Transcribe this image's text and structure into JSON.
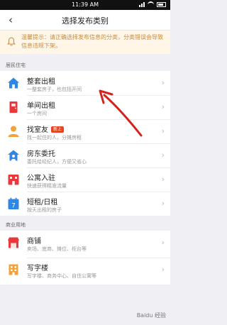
{
  "status_bar": {
    "time": "11:39 AM"
  },
  "header": {
    "title": "选择发布类别"
  },
  "notice": {
    "text": "温馨提示：请正确选择发布信息的分类，分类错误会导致信息违规下架。"
  },
  "sections": [
    {
      "title": "居民住宅",
      "items": [
        {
          "name": "整套出租",
          "desc": "一整套房子，也包括开间",
          "icon": "house-icon",
          "color": "#2f86e5"
        },
        {
          "name": "单间出租",
          "desc": "一个房间",
          "icon": "door-icon",
          "color": "#e9373a"
        },
        {
          "name": "找室友",
          "badge": "新上",
          "desc": "找一起住的人，分摊房租",
          "icon": "person-icon",
          "color": "#f2a23a"
        },
        {
          "name": "房东委托",
          "desc": "委托给经纪人，方便又省心",
          "icon": "delegate-icon",
          "color": "#2f86e5"
        },
        {
          "name": "公寓入驻",
          "desc": "快速获得精准流量",
          "icon": "apartment-icon",
          "color": "#e9373a"
        },
        {
          "name": "短租/日租",
          "desc": "按天出租的房子",
          "icon": "calendar-icon",
          "color": "#2f86e5",
          "calendar_day": "7"
        }
      ]
    },
    {
      "title": "商业用地",
      "items": [
        {
          "name": "商铺",
          "desc": "卖场、底商、摊位、柜台等",
          "icon": "shop-icon",
          "color": "#e9373a"
        },
        {
          "name": "写字楼",
          "desc": "写字楼、商务中心、自住公寓等",
          "icon": "office-icon",
          "color": "#f2a23a"
        }
      ]
    }
  ],
  "watermark": "Baidu 经验"
}
